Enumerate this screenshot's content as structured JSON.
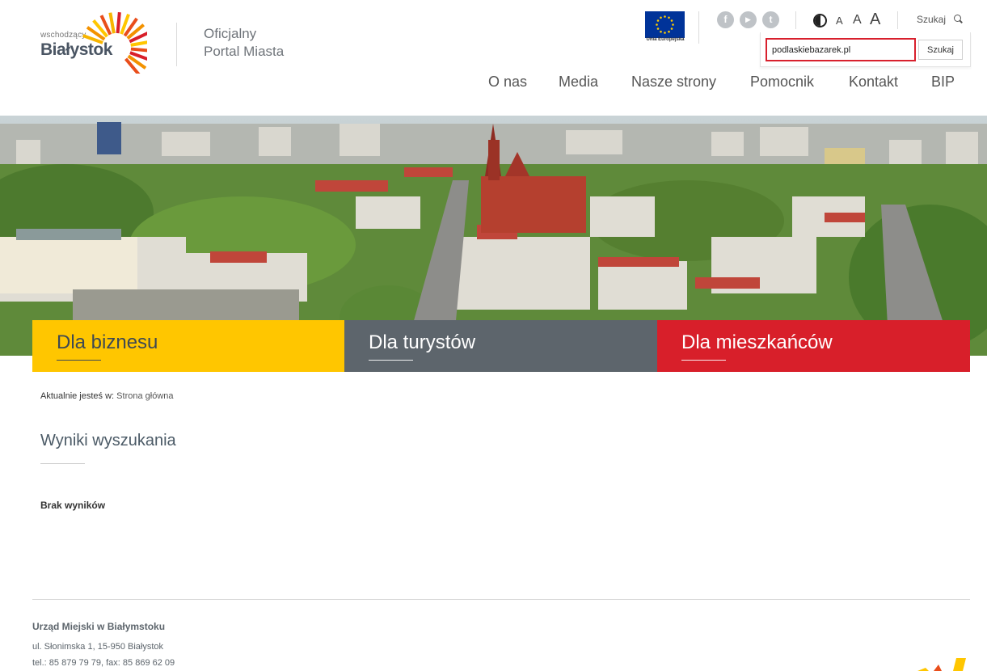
{
  "colors": {
    "brand_yellow": "#ffc600",
    "brand_gray": "#5d656c",
    "brand_red": "#d81f2a",
    "search_border": "#d8202d"
  },
  "logo": {
    "small": "wschodzący",
    "big": "Białystok",
    "icon": "sunburst-logo-icon"
  },
  "tagline": {
    "line1": "Oficjalny",
    "line2": "Portal Miasta"
  },
  "eu": {
    "label": "Unia Europejska",
    "icon": "eu-flag-icon"
  },
  "social": {
    "facebook": "f",
    "youtube": "▶",
    "twitter": "t"
  },
  "font_size": {
    "small": "A",
    "medium": "A",
    "large": "A"
  },
  "search": {
    "link": "Szukaj",
    "input_value": "podlaskiebazarek.pl",
    "button": "Szukaj"
  },
  "nav": [
    "O nas",
    "Media",
    "Nasze strony",
    "Pomocnik",
    "Kontakt",
    "BIP"
  ],
  "tiles": {
    "business": "Dla biznesu",
    "tourists": "Dla turystów",
    "residents": "Dla mieszkańców"
  },
  "breadcrumb": {
    "prefix": "Aktualnie jesteś w:",
    "link": "Strona główna"
  },
  "page_title": "Wyniki wyszukania",
  "no_results": "Brak wyników",
  "footer": {
    "org": "Urząd Miejski w Białymstoku",
    "address": "ul. Słonimska 1, 15-950 Białystok",
    "phone": "tel.: 85 879 79 79, fax: 85 869 62 09"
  }
}
